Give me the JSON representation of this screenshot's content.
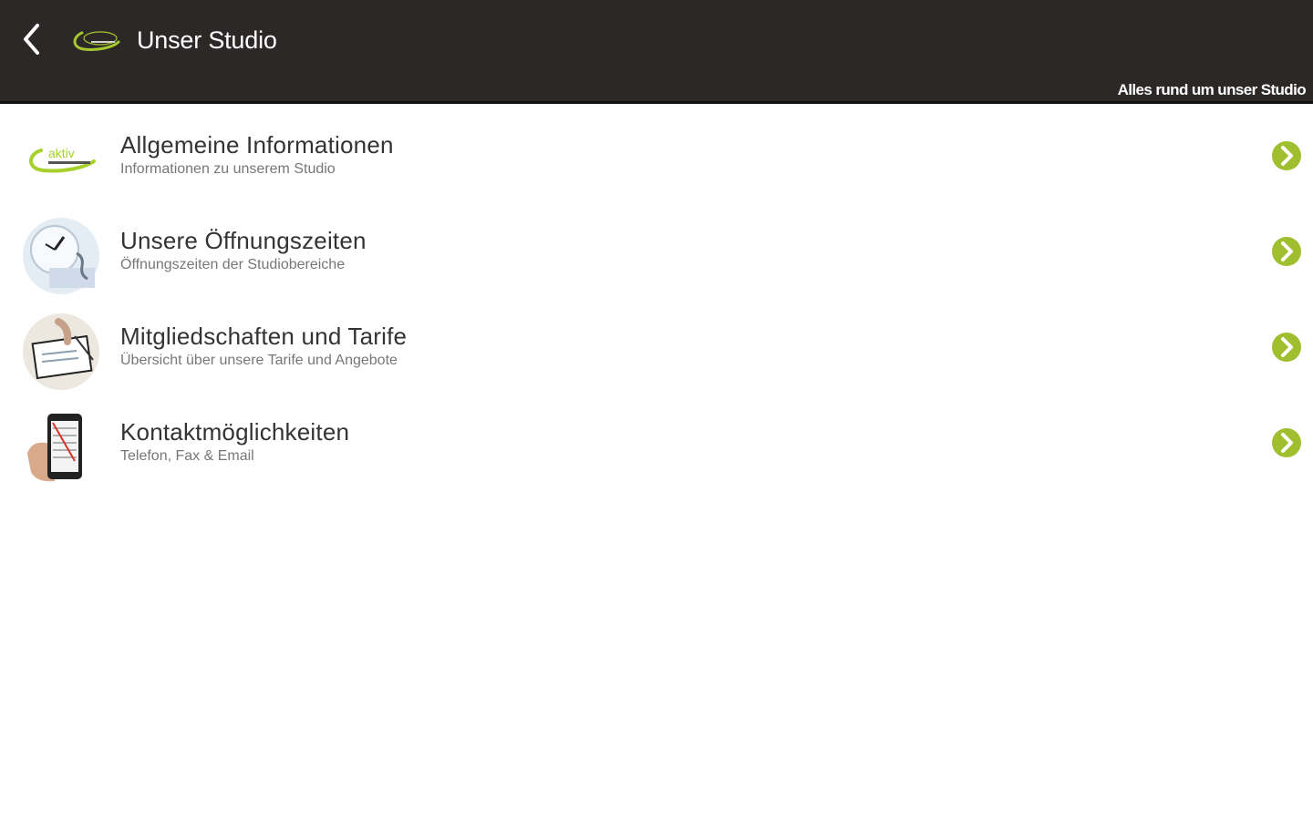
{
  "header": {
    "title": "Unser Studio",
    "subtitle": "Alles rund um unser Studio",
    "back_icon": "chevron-left-icon",
    "logo": "aktiv-logo"
  },
  "colors": {
    "header_bg": "#2b2827",
    "accent_green": "#9fbf2f",
    "title_text": "#333333",
    "subtitle_text": "#777777"
  },
  "items": [
    {
      "title": "Allgemeine Informationen",
      "subtitle": "Informationen zu unserem Studio",
      "icon": "aktiv-logo-icon"
    },
    {
      "title": "Unsere Öffnungszeiten",
      "subtitle": "Öffnungszeiten der Studiobereiche",
      "icon": "clock-icon"
    },
    {
      "title": "Mitgliedschaften und Tarife",
      "subtitle": "Übersicht über unsere Tarife und Angebote",
      "icon": "contract-icon"
    },
    {
      "title": "Kontaktmöglichkeiten",
      "subtitle": "Telefon, Fax & Email",
      "icon": "phone-icon"
    }
  ]
}
